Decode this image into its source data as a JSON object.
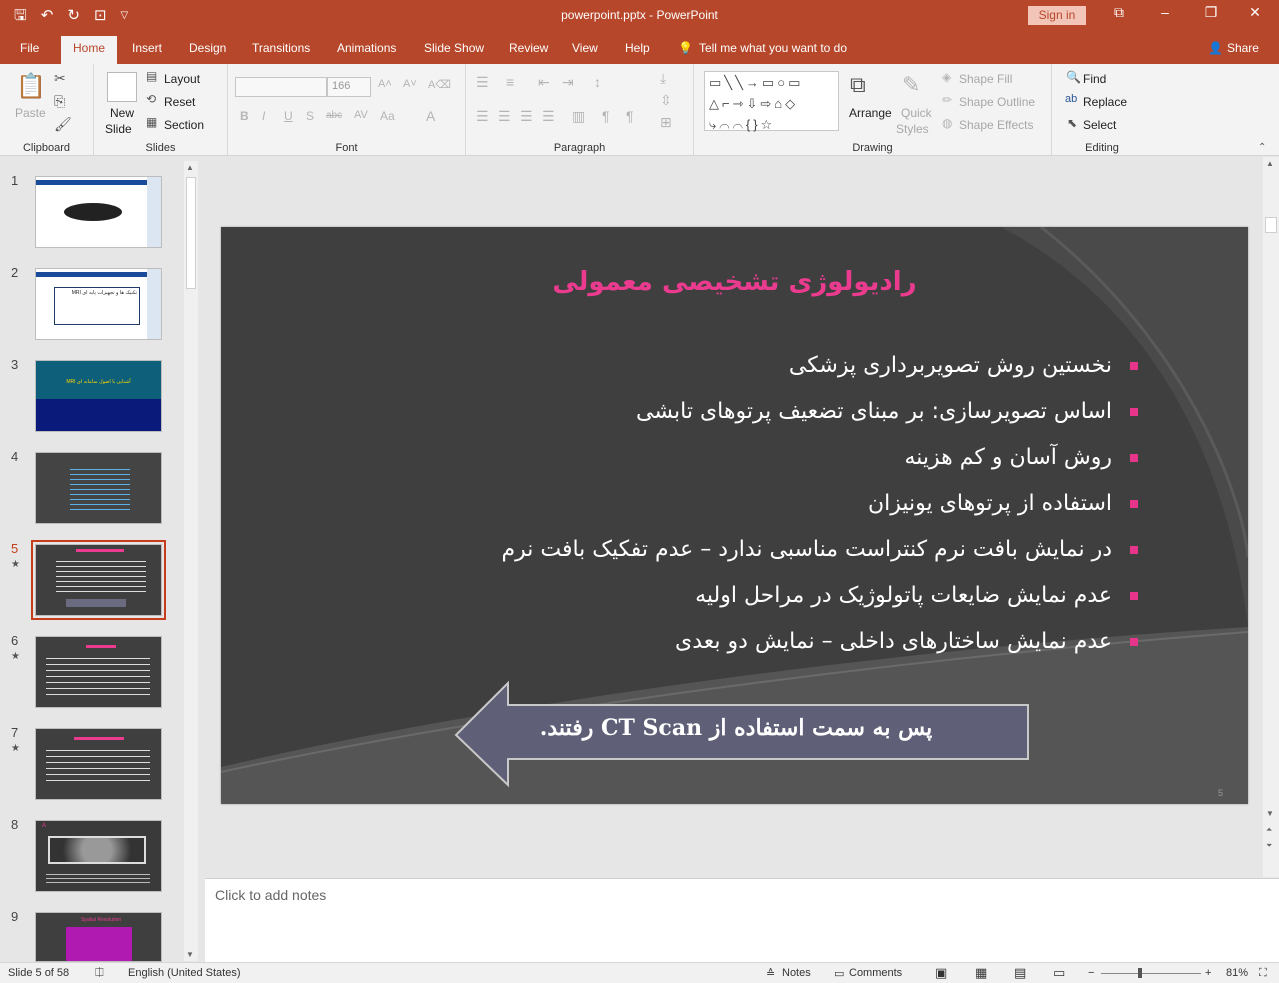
{
  "window": {
    "title": "powerpoint.pptx  -  PowerPoint",
    "signin_label": "Sign in"
  },
  "qat": {
    "save_icon": "save-icon",
    "undo_icon": "undo-icon",
    "redo_icon": "redo-icon",
    "present_icon": "present-icon",
    "customize_icon": "chevron-down-icon"
  },
  "tabs": [
    "File",
    "Home",
    "Insert",
    "Design",
    "Transitions",
    "Animations",
    "Slide Show",
    "Review",
    "View",
    "Help"
  ],
  "active_tab": "Home",
  "tell_me": "Tell me what you want to do",
  "share_label": "Share",
  "ribbon": {
    "clipboard": {
      "paste": "Paste",
      "label": "Clipboard"
    },
    "slides": {
      "new_slide_line1": "New",
      "new_slide_line2": "Slide",
      "layout": "Layout",
      "reset": "Reset",
      "section": "Section",
      "label": "Slides"
    },
    "font": {
      "font_name": "",
      "font_size": "166",
      "label": "Font"
    },
    "paragraph": {
      "label": "Paragraph"
    },
    "drawing": {
      "arrange": "Arrange",
      "quick_styles_line1": "Quick",
      "quick_styles_line2": "Styles",
      "shape_fill": "Shape Fill",
      "shape_outline": "Shape Outline",
      "shape_effects": "Shape Effects",
      "label": "Drawing"
    },
    "editing": {
      "find": "Find",
      "replace": "Replace",
      "select": "Select",
      "label": "Editing"
    }
  },
  "thumbnails": [
    {
      "num": "1",
      "star": ""
    },
    {
      "num": "2",
      "star": ""
    },
    {
      "num": "3",
      "star": ""
    },
    {
      "num": "4",
      "star": ""
    },
    {
      "num": "5",
      "star": "★"
    },
    {
      "num": "6",
      "star": "★"
    },
    {
      "num": "7",
      "star": "★"
    },
    {
      "num": "8",
      "star": ""
    },
    {
      "num": "9",
      "star": ""
    }
  ],
  "thumb_text": {
    "t2": "تکنیک ها و تجهیزات پایه ای MRI",
    "t3": "آشنایی با اصول سامانه ای MRI",
    "t8_header": "A",
    "t9_title": "Spatial Resolution"
  },
  "slide": {
    "title": "رادیولوژی تشخیصی معمولی",
    "bullets": [
      "نخستین روش تصویربرداری پزشکی",
      "اساس تصویرسازی: بر مبنای تضعیف پرتوهای تابشی",
      "روش آسان و کم هزینه",
      "استفاده از پرتوهای یونیزان",
      "در نمایش بافت نرم کنتراست مناسبی ندارد – عدم تفکیک بافت نرم",
      "عدم نمایش ضایعات پاتولوژیک در مراحل اولیه",
      "عدم نمایش ساختارهای داخلی – نمایش دو بعدی"
    ],
    "arrow_text": "پس به سمت استفاده از CT Scan رفتند.",
    "slide_number": "5"
  },
  "notes_placeholder": "Click to add notes",
  "status": {
    "slide_of": "Slide 5 of 58",
    "language": "English (United States)",
    "notes": "Notes",
    "comments": "Comments",
    "zoom": "81%"
  },
  "colors": {
    "accent": "#b7472a",
    "title_pink": "#ea3b8f",
    "bullet_pink": "#e8358c",
    "slide_bg": "#3f3f3f"
  }
}
